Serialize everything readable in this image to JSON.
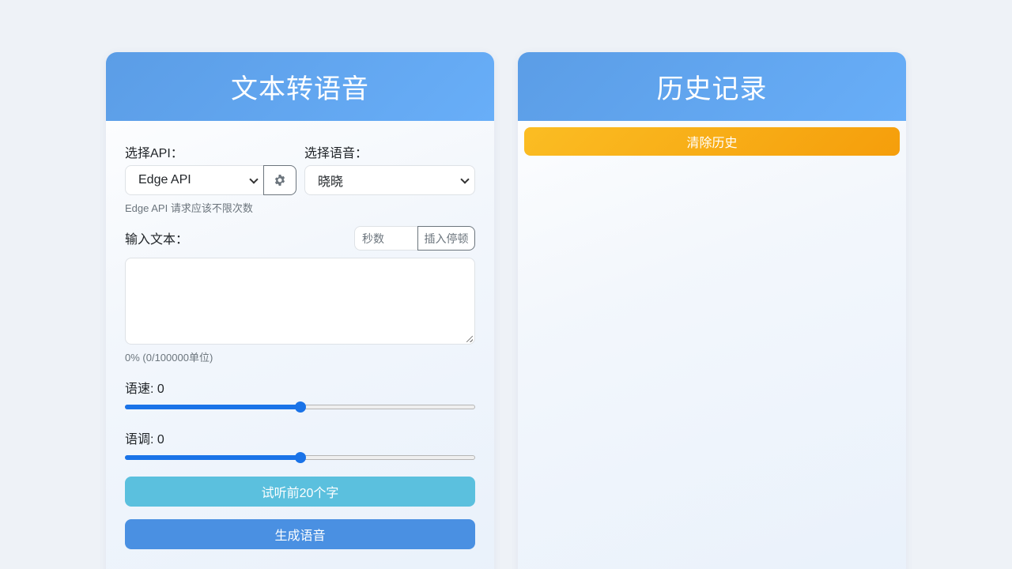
{
  "left_panel": {
    "title": "文本转语音",
    "api_label": "选择API：",
    "api_selected": "Edge API",
    "api_hint": "Edge API 请求应该不限次数",
    "voice_label": "选择语音：",
    "voice_selected": "晓晓",
    "input_label": "输入文本：",
    "pause_placeholder": "秒数",
    "pause_button": "插入停顿",
    "text_value": "",
    "char_count": "0% (0/100000单位)",
    "speed_label": "语速: 0",
    "speed_fraction": 0.5,
    "pitch_label": "语调: 0",
    "pitch_fraction": 0.5,
    "preview_button": "试听前20个字",
    "generate_button": "生成语音"
  },
  "right_panel": {
    "title": "历史记录",
    "clear_button": "清除历史"
  },
  "colors": {
    "header_gradient_start": "#5b9de6",
    "header_gradient_end": "#68aef8",
    "preview_button": "#5bc0de",
    "generate_button": "#4a90e2",
    "clear_button_start": "#fbbd23",
    "clear_button_end": "#f59e0b",
    "slider_accent": "#1a73e8"
  },
  "icons": {
    "settings": "gear-icon"
  }
}
